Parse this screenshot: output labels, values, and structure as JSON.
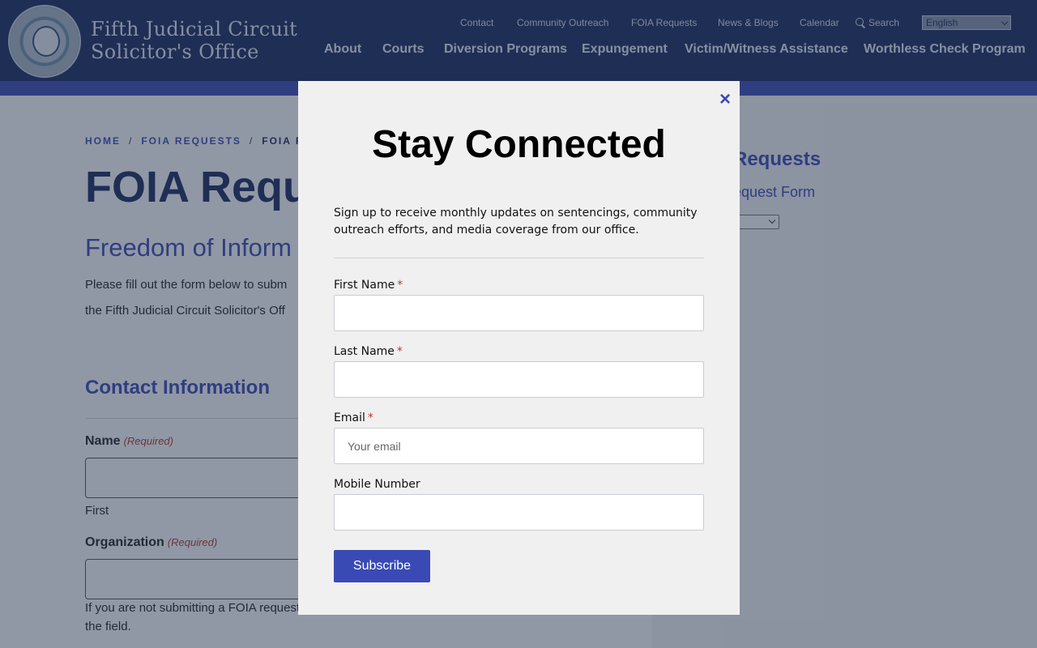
{
  "header": {
    "site_title_line1": "Fifth Judicial Circuit",
    "site_title_line2": "Solicitor's Office",
    "seal_icon": "seal-logo-icon",
    "utility_nav": {
      "contact": "Contact",
      "community_outreach": "Community Outreach",
      "foia_requests": "FOIA Requests",
      "news_blogs": "News & Blogs",
      "calendar": "Calendar",
      "search": "Search"
    },
    "language": {
      "selected": "English"
    },
    "main_nav": {
      "about": "About",
      "courts": "Courts",
      "diversion": "Diversion Programs",
      "expungement": "Expungement",
      "victim_witness": "Victim/Witness Assistance",
      "worthless_check": "Worthless Check Program"
    }
  },
  "breadcrumb": {
    "home": "HOME",
    "sep": "/",
    "foia": "FOIA REQUESTS",
    "current": "FOIA RE"
  },
  "page": {
    "title": "FOIA Requ",
    "subtitle": "Freedom of Inform",
    "intro_line1": "Please fill out the form below to subm",
    "intro_line2": "the Fifth Judicial Circuit Solicitor's Off",
    "contact_heading": "Contact Information",
    "name_label": "Name",
    "required_label": "(Required)",
    "first_sublabel": "First",
    "org_label": "Organization",
    "org_help_line1": "If you are not submitting a FOIA request",
    "org_help_line2": "the field."
  },
  "sidebar": {
    "heading": "Requests",
    "link": "equest Form"
  },
  "modal": {
    "title": "Stay Connected",
    "description": "Sign up to receive monthly updates on sentencings, community outreach efforts, and media coverage from our office.",
    "close_symbol": "×",
    "fields": {
      "first_name_label": "First Name",
      "last_name_label": "Last Name",
      "email_label": "Email",
      "email_placeholder": "Your email",
      "mobile_label": "Mobile Number",
      "required_marker": "*"
    },
    "subscribe_label": "Subscribe"
  },
  "colors": {
    "header_bg": "#1b2a5e",
    "accent_blue": "#3a4ab5",
    "required_red": "#c0392b"
  }
}
